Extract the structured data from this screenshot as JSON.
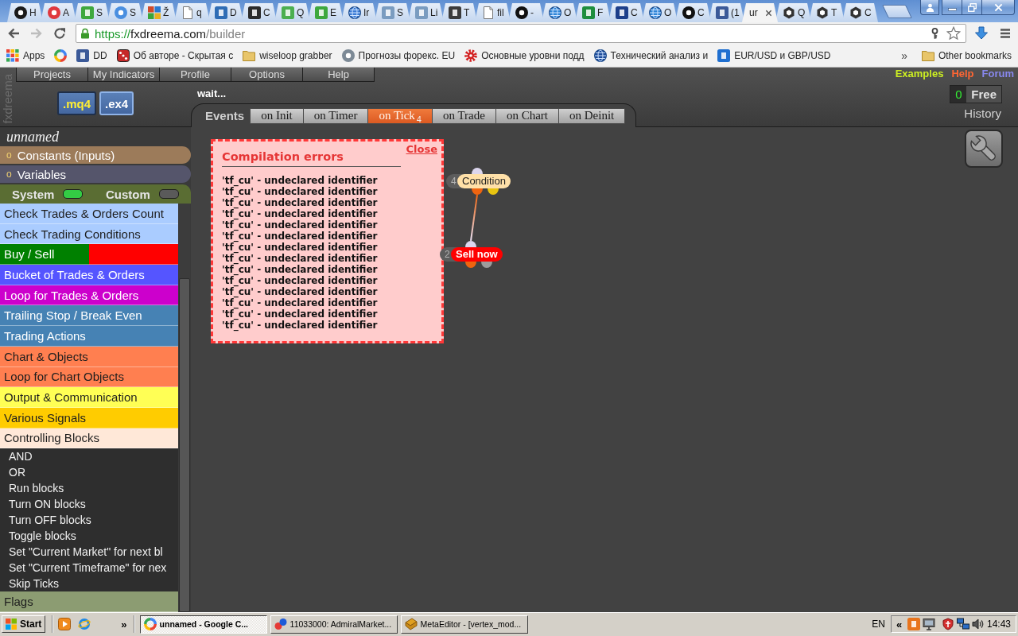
{
  "browser": {
    "tabs": [
      {
        "title": "H",
        "selected": false
      },
      {
        "title": "A",
        "selected": false
      },
      {
        "title": "S",
        "selected": false
      },
      {
        "title": "S",
        "selected": false
      },
      {
        "title": "Ž",
        "selected": false
      },
      {
        "title": "q",
        "selected": false
      },
      {
        "title": "D",
        "selected": false
      },
      {
        "title": "C",
        "selected": false
      },
      {
        "title": "Q",
        "selected": false
      },
      {
        "title": "E",
        "selected": false
      },
      {
        "title": "Ir",
        "selected": false
      },
      {
        "title": "S",
        "selected": false
      },
      {
        "title": "Li",
        "selected": false
      },
      {
        "title": "T",
        "selected": false
      },
      {
        "title": "fil",
        "selected": false
      },
      {
        "title": "-",
        "selected": false
      },
      {
        "title": "O",
        "selected": false
      },
      {
        "title": "F",
        "selected": false
      },
      {
        "title": "C",
        "selected": false
      },
      {
        "title": "O",
        "selected": false
      },
      {
        "title": "C",
        "selected": false
      },
      {
        "title": "(1",
        "selected": false
      },
      {
        "title": "ur",
        "selected": true
      },
      {
        "title": "Q",
        "selected": false
      },
      {
        "title": "T",
        "selected": false
      },
      {
        "title": "C",
        "selected": false
      }
    ],
    "address": {
      "scheme": "https://",
      "host": "fxdreema.com",
      "path": "/builder"
    },
    "bookmarks": [
      {
        "kind": "apps",
        "label": "Apps"
      },
      {
        "kind": "link"
      },
      {
        "kind": "link",
        "label": "DD"
      },
      {
        "kind": "link",
        "label": "Об авторе - Скрытая с"
      },
      {
        "kind": "folder",
        "label": "wiseloop grabber"
      },
      {
        "kind": "link",
        "label": "Прогнозы форекс. EU"
      },
      {
        "kind": "link",
        "label": "Основные уровни подд"
      },
      {
        "kind": "link",
        "label": "Технический анализ и"
      },
      {
        "kind": "link",
        "label": "EUR/USD и GBP/USD"
      }
    ],
    "bookmarks_more": "»",
    "other_bookmarks": "Other bookmarks"
  },
  "app": {
    "logo": "fxdreema",
    "menu": [
      "Projects",
      "My Indicators",
      "Profile",
      "Options",
      "Help"
    ],
    "file_types": [
      {
        "label": ".mq4",
        "selected": false
      },
      {
        "label": ".ex4",
        "selected": true
      }
    ],
    "status": "wait...",
    "events": {
      "label": "Events",
      "tabs": [
        {
          "label": "on Init",
          "selected": false
        },
        {
          "label": "on Timer",
          "selected": false
        },
        {
          "label": "on Tick",
          "selected": true,
          "count": "4"
        },
        {
          "label": "on Trade",
          "selected": false
        },
        {
          "label": "on Chart",
          "selected": false
        },
        {
          "label": "on Deinit",
          "selected": false
        }
      ]
    },
    "links": [
      {
        "label": "Examples",
        "color": "#ccee22"
      },
      {
        "label": "Help",
        "color": "#ff6633"
      },
      {
        "label": "Forum",
        "color": "#8888ee"
      }
    ],
    "plan": {
      "count": "0",
      "label": "Free"
    },
    "history": "History"
  },
  "sidebar": {
    "project_name": "unnamed",
    "sections": [
      {
        "bullet": "o",
        "label": "Constants (Inputs)",
        "color": "#9c7b5a"
      },
      {
        "bullet": "o",
        "label": "Variables",
        "color": "#55556b"
      }
    ],
    "toggles": [
      {
        "label": "System",
        "on": true
      },
      {
        "label": "Custom",
        "on": false
      }
    ],
    "categories": [
      {
        "label": "Check Trades & Orders Count",
        "color": "#aaccff"
      },
      {
        "label": "Check Trading Conditions",
        "color": "#aaccff"
      },
      {
        "label": "Buy / Sell",
        "color": "#008000",
        "right_half": {
          "color": "#ff0000"
        }
      },
      {
        "label": "Bucket of Trades & Orders",
        "color": "#5555ff"
      },
      {
        "label": "Loop for Trades & Orders",
        "color": "#cc00cc"
      },
      {
        "label": "Trailing Stop / Break Even",
        "color": "#4682b4"
      },
      {
        "label": "Trading Actions",
        "color": "#4682b4"
      },
      {
        "label": "Chart & Objects",
        "color": "#ff7f50"
      },
      {
        "label": "Loop for Chart Objects",
        "color": "#ff7f50"
      },
      {
        "label": "Output & Communication",
        "color": "#ffff55"
      },
      {
        "label": "Various Signals",
        "color": "#ffcc00"
      },
      {
        "label": "Controlling Blocks",
        "color": "#ffe8d8",
        "children": [
          {
            "label": "AND"
          },
          {
            "label": "OR"
          },
          {
            "label": "Run blocks"
          },
          {
            "label": "Turn ON blocks"
          },
          {
            "label": "Turn OFF blocks"
          },
          {
            "label": "Toggle blocks"
          },
          {
            "label": "Set \"Current Market\" for next bl"
          },
          {
            "label": "Set \"Current Timeframe\" for nex"
          },
          {
            "label": "Skip Ticks"
          }
        ]
      },
      {
        "label": "Flags",
        "color": "#8c9c72"
      }
    ]
  },
  "canvas": {
    "dialog": {
      "title": "Compilation errors",
      "close": "Close",
      "errors": [
        "'tf_cu' - undeclared identifier",
        "'tf_cu' - undeclared identifier",
        "'tf_cu' - undeclared identifier",
        "'tf_cu' - undeclared identifier",
        "'tf_cu' - undeclared identifier",
        "'tf_cu' - undeclared identifier",
        "'tf_cu' - undeclared identifier",
        "'tf_cu' - undeclared identifier",
        "'tf_cu' - undeclared identifier",
        "'tf_cu' - undeclared identifier",
        "'tf_cu' - undeclared identifier",
        "'tf_cu' - undeclared identifier",
        "'tf_cu' - undeclared identifier",
        "'tf_cu' - undeclared identifier"
      ]
    },
    "nodes": [
      {
        "number": "4",
        "label": "Condition",
        "kind": "condition",
        "color": "#ffe0a8",
        "children": [
          {
            "number": "2",
            "label": "Sell now",
            "kind": "action",
            "color": "#ff0000"
          }
        ]
      }
    ]
  },
  "taskbar": {
    "start": "Start",
    "quick_launch_more": "»",
    "tasks": [
      {
        "label": "unnamed - Google C...",
        "selected": true
      },
      {
        "label": "11033000: AdmiralMarket...",
        "selected": false
      },
      {
        "label": "MetaEditor - [vertex_mod...",
        "selected": false
      }
    ],
    "language": "EN",
    "tray_expand": "«",
    "clock": "14:43"
  }
}
